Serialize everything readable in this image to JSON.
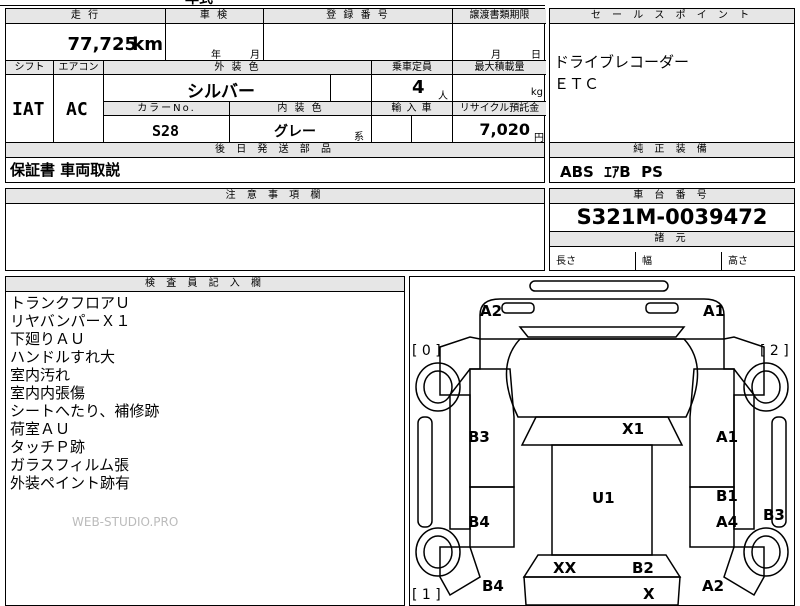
{
  "top_partial": "年式",
  "mileage": {
    "header": "走 行",
    "value": "77,725",
    "unit": "km"
  },
  "inspection": {
    "header": "車 検",
    "year_unit": "年",
    "month_unit": "月"
  },
  "registration": {
    "header": "登 録 番 号"
  },
  "transfer": {
    "header": "譲渡書類期限",
    "month_unit": "月",
    "day_unit": "日"
  },
  "shift": {
    "header": "シフト",
    "value": "IAT"
  },
  "aircon": {
    "header": "エアコン",
    "value": "AC"
  },
  "exterior_color": {
    "header": "外 装 色",
    "value": "シルバー"
  },
  "capacity": {
    "header": "乗車定員",
    "value": "4",
    "unit": "人"
  },
  "max_load": {
    "header": "最大積載量",
    "unit": "kg"
  },
  "color_no": {
    "header": "カラーNo.",
    "value": "S28"
  },
  "interior_color": {
    "header": "内 装 色",
    "value": "グレー",
    "suffix": "系"
  },
  "import": {
    "header": "輸 入 車"
  },
  "recycle": {
    "header": "リサイクル預託金",
    "value": "7,020",
    "unit": "円"
  },
  "later_parts": {
    "header": "後 日 発 送 部 品",
    "value": "保証書 車両取説"
  },
  "notes": {
    "header": "注 意 事 項 欄"
  },
  "sale_points": {
    "header": "セ ー ル ス ポ イ ン ト",
    "lines": [
      "ドライブレコーダー",
      "ＥＴＣ"
    ]
  },
  "equipment": {
    "header": "純 正 装 備",
    "value": "ABS  ｴｱB  PS"
  },
  "chassis": {
    "header": "車 台 番 号",
    "value": "S321M-0039472"
  },
  "dimensions": {
    "header": "諸 元",
    "length": "長さ",
    "width": "幅",
    "height": "高さ"
  },
  "inspector": {
    "header": "検 査 員 記 入 欄",
    "lines": [
      "トランクフロアＵ",
      "リヤバンパーＸ１",
      "下廻りＡＵ",
      "ハンドルすれ大",
      "室内汚れ",
      "室内内張傷",
      "シートへたり、補修跡",
      "荷室ＡＵ",
      "タッチＰ跡",
      "ガラスフィルム張",
      "外装ペイント跡有"
    ],
    "watermark": "WEB-STUDIO.PRO"
  },
  "diagram": {
    "marks": [
      {
        "id": "a2-front-left",
        "text": "A2"
      },
      {
        "id": "a1-front-right",
        "text": "A1"
      },
      {
        "id": "x1-hood",
        "text": "X1"
      },
      {
        "id": "b3-left-front",
        "text": "B3"
      },
      {
        "id": "a1-right-front",
        "text": "A1"
      },
      {
        "id": "u1-roof",
        "text": "U1"
      },
      {
        "id": "b1-right-mid",
        "text": "B1"
      },
      {
        "id": "b4-left-mid",
        "text": "B4"
      },
      {
        "id": "a4-right-mid",
        "text": "A4"
      },
      {
        "id": "b3-right-edge",
        "text": "B3"
      },
      {
        "id": "xx-rear-left",
        "text": "XX"
      },
      {
        "id": "b2-rear-right",
        "text": "B2"
      },
      {
        "id": "b4-left-rear",
        "text": "B4"
      },
      {
        "id": "a2-right-rear",
        "text": "A2"
      },
      {
        "id": "x-rear",
        "text": "X"
      }
    ],
    "brackets": [
      {
        "id": "bracket-0",
        "text": "[ 0 ]"
      },
      {
        "id": "bracket-2",
        "text": "[ 2 ]"
      },
      {
        "id": "bracket-1",
        "text": "[ 1 ]"
      }
    ]
  }
}
